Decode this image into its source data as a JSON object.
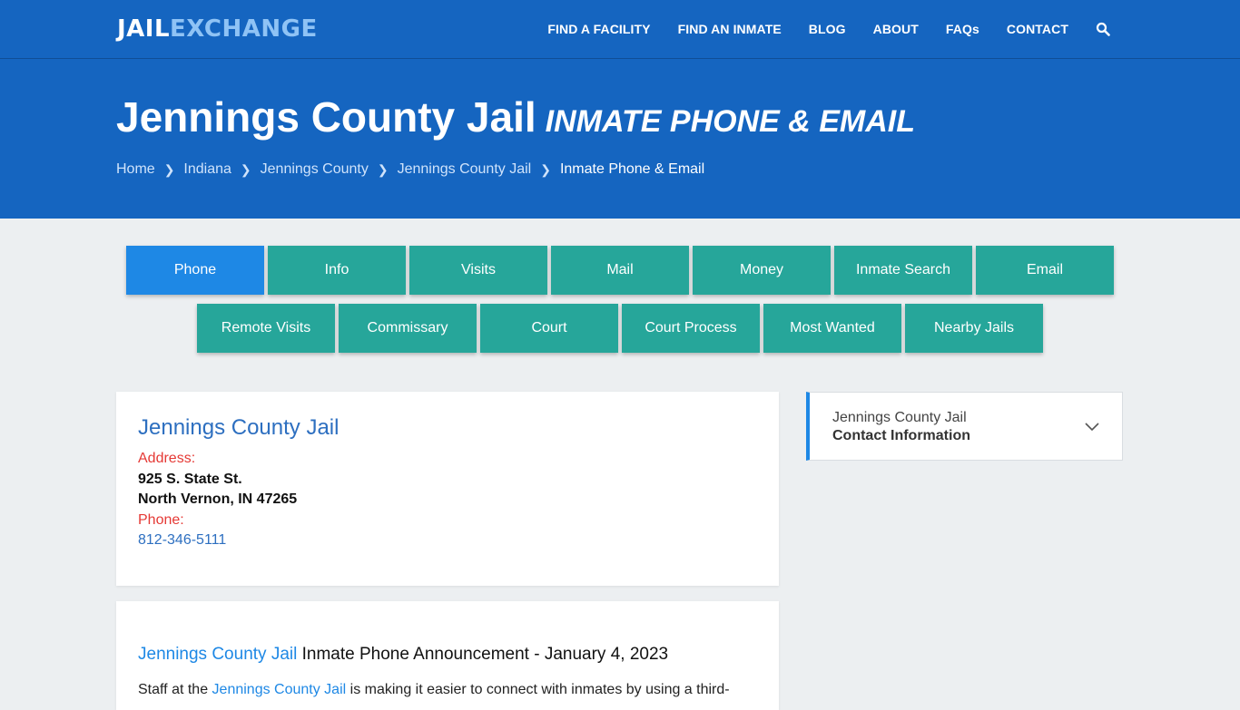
{
  "header": {
    "logo": {
      "part1": "JAIL",
      "part2": "EXCHANGE"
    },
    "nav": [
      "FIND A FACILITY",
      "FIND AN INMATE",
      "BLOG",
      "ABOUT",
      "FAQs",
      "CONTACT"
    ],
    "search_icon": "search-icon"
  },
  "hero": {
    "title": "Jennings County Jail",
    "subtitle": "INMATE PHONE & EMAIL",
    "breadcrumb": [
      "Home",
      "Indiana",
      "Jennings County",
      "Jennings County Jail"
    ],
    "breadcrumb_current": "Inmate Phone & Email"
  },
  "tabs": {
    "row1": [
      "Phone",
      "Info",
      "Visits",
      "Mail",
      "Money",
      "Inmate Search",
      "Email"
    ],
    "row2": [
      "Remote Visits",
      "Commissary",
      "Court",
      "Court Process",
      "Most Wanted",
      "Nearby Jails"
    ],
    "active": "Phone"
  },
  "facility": {
    "name": "Jennings County Jail",
    "address_label": "Address:",
    "address_line1": "925 S. State St.",
    "address_line2": "North Vernon, IN 47265",
    "phone_label": "Phone:",
    "phone": "812-346-5111"
  },
  "announcement": {
    "link": "Jennings County Jail",
    "title": " Inmate Phone Announcement - January 4, 2023",
    "body_pre": "Staff at the ",
    "body_link": "Jennings County Jail",
    "body_post": " is making it easier to connect with inmates by using a third-"
  },
  "sidebar": {
    "line1": "Jennings County Jail",
    "line2": "Contact Information"
  },
  "colors": {
    "header_blue": "#1565c0",
    "tab_teal": "#26a69a",
    "tab_active": "#1e88e5",
    "label_red": "#e53935",
    "link_blue": "#2d6fc0"
  }
}
